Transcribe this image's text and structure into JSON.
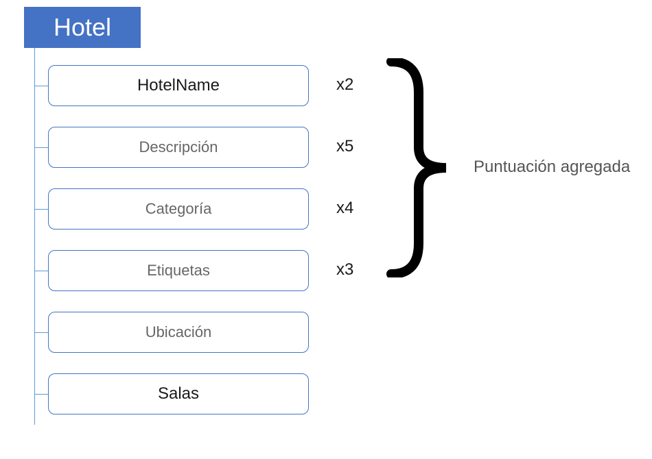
{
  "root": {
    "label": "Hotel"
  },
  "fields": [
    {
      "label": "HotelName",
      "multiplier": "x2",
      "bold": true
    },
    {
      "label": "Descripción",
      "multiplier": "x5",
      "bold": false
    },
    {
      "label": "Categoría",
      "multiplier": "x4",
      "bold": false
    },
    {
      "label": "Etiquetas",
      "multiplier": "x3",
      "bold": false
    },
    {
      "label": "Ubicación",
      "multiplier": "",
      "bold": false
    },
    {
      "label": "Salas",
      "multiplier": "",
      "bold": true
    }
  ],
  "aggregate": {
    "label": "Puntuación agregada"
  }
}
